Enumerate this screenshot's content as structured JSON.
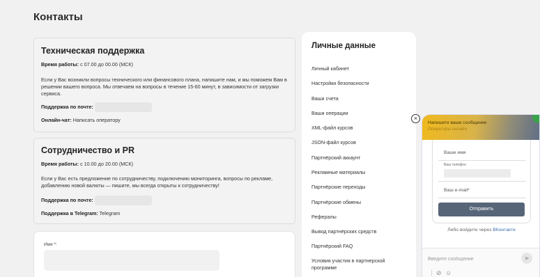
{
  "page": {
    "title": "Контакты"
  },
  "support": {
    "title": "Техническая поддержка",
    "hours_label": "Время работы:",
    "hours_value": " с 07.00 до 00.00 (МСК)",
    "description": "Если у Вас возникли вопросы технического или финансового плана, напишите нам, и мы поможем Вам в решении вашего вопроса. Мы отвечаем на вопросы в течение 15-60 минут, в зависимости от загрузки сервиса.",
    "email_label": "Поддержка по почте:",
    "chat_label": "Онлайн-чат:",
    "chat_link": " Написать оператору"
  },
  "partnership": {
    "title": "Сотрудничество и PR",
    "hours_label": "Время работы:",
    "hours_value": " с 10.00 до 20.00 (МСК)",
    "description": "Если у Вас есть предложение по сотрудничеству, подключению мониторинга, вопросы по рекламе, добавлению новой валюты — пишите, мы всегда открыты к сотрудничеству!",
    "email_label": "Поддержка по почте:",
    "telegram_label": "Поддержка в Telegram:",
    "telegram_link": " Telegram"
  },
  "contact_form": {
    "name_label": "Имя *:"
  },
  "sidebar": {
    "title": "Личные данные",
    "items": [
      "Личный кабинет",
      "Настройки безопасности",
      "Ваши счета",
      "Ваши операции",
      "XML-файл курсов",
      "JSON-файл курсов",
      "Партнёрский аккаунт",
      "Рекламные материалы",
      "Партнёрские переходы",
      "Партнёрские обмены",
      "Рефералы",
      "Вывод партнёрских средств",
      "Партнёрский FAQ",
      "Условия участия в партнерской программе"
    ]
  },
  "chat_widget": {
    "header_title": "Напишите ваше сообщение",
    "header_status": "Операторы онлайн",
    "name_placeholder": "Ваше имя",
    "phone_label": "Ваш телефон",
    "email_placeholder": "Ваш e-mail*",
    "send_label": "Отправить",
    "vk_prefix": "Либо войдите через ",
    "vk_link": "ВКонтакте",
    "message_placeholder": "Введите сообщение",
    "close_glyph": "×",
    "send_glyph": "➤",
    "menu_glyph": "⋮",
    "attach_glyph": "⊘",
    "emoji_glyph": "☺"
  }
}
